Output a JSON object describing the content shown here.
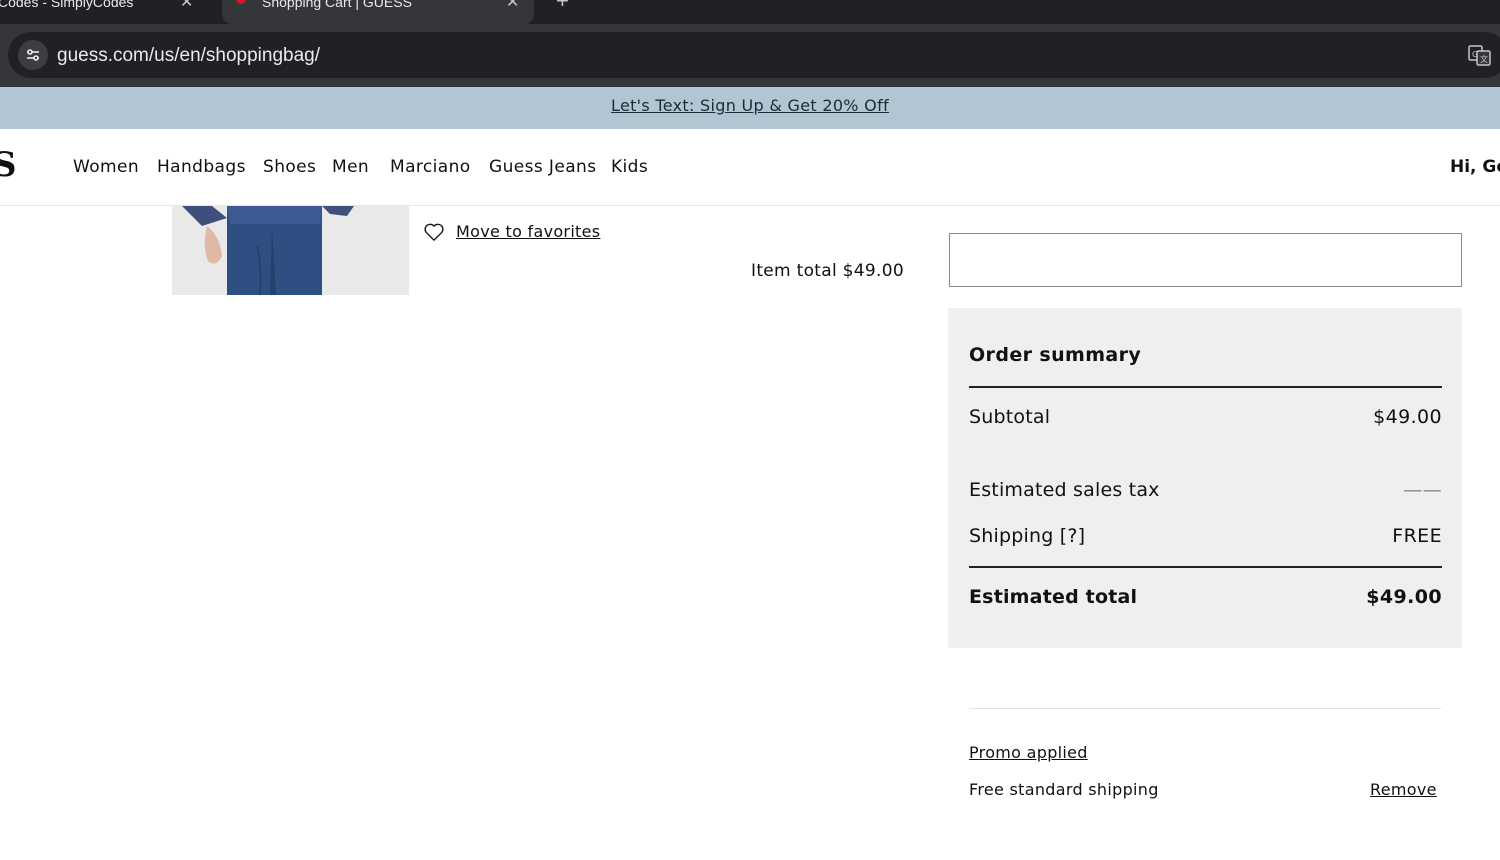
{
  "browser": {
    "tabs": [
      {
        "title": "Codes - SimplyCodes",
        "close": "✕"
      },
      {
        "title": "Shopping Cart | GUESS",
        "close": "✕"
      }
    ],
    "new_tab": "+",
    "url": "guess.com/us/en/shoppingbag/"
  },
  "promo_banner": {
    "text": "Let's Text: Sign Up & Get 20% Off"
  },
  "header": {
    "logo": "S",
    "nav": [
      "Women",
      "Handbags",
      "Shoes",
      "Men",
      "Marciano",
      "Guess Jeans",
      "Kids"
    ],
    "greeting": "Hi, Go"
  },
  "item": {
    "move_to_favorites": "Move to favorites",
    "total_label": "Item total $49.00"
  },
  "order_summary": {
    "title": "Order summary",
    "subtotal_label": "Subtotal",
    "subtotal_value": "$49.00",
    "tax_label": "Estimated sales tax",
    "tax_value": "——",
    "shipping_label": "Shipping [?]",
    "shipping_value": "FREE",
    "total_label": "Estimated total",
    "total_value": "$49.00"
  },
  "promo": {
    "applied_label": "Promo applied",
    "description": "Free standard shipping",
    "remove_label": "Remove"
  }
}
